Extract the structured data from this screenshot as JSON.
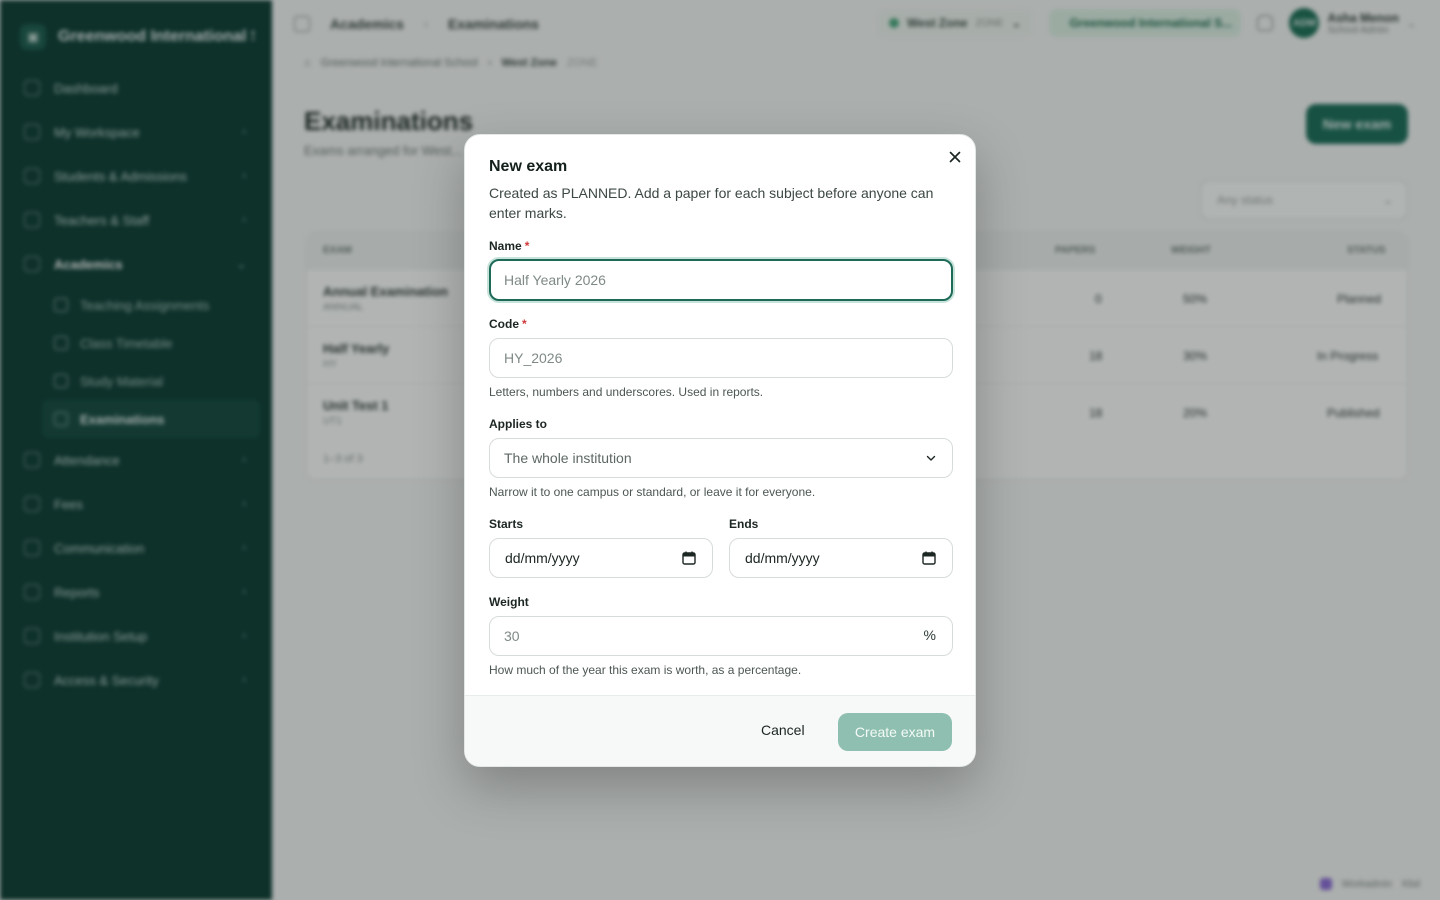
{
  "sidebar": {
    "brand": "Greenwood International Sc...",
    "items": [
      {
        "label": "Dashboard"
      },
      {
        "label": "My Workspace"
      },
      {
        "label": "Students & Admissions"
      },
      {
        "label": "Teachers & Staff"
      },
      {
        "label": "Academics"
      },
      {
        "label": "Attendance"
      },
      {
        "label": "Fees"
      },
      {
        "label": "Communication"
      },
      {
        "label": "Reports"
      },
      {
        "label": "Institution Setup"
      },
      {
        "label": "Access & Security"
      }
    ],
    "academics_sub": [
      {
        "label": "Teaching Assignments"
      },
      {
        "label": "Class Timetable"
      },
      {
        "label": "Study Material"
      },
      {
        "label": "Examinations"
      }
    ]
  },
  "topbar": {
    "crumb_1": "Academics",
    "crumb_2": "Examinations",
    "zone": "West Zone",
    "zone_code": "ZONE",
    "school": "Greenwood International S...",
    "user_initials": "ADM",
    "user_name": "Asha Menon",
    "user_role": "School Admin"
  },
  "page": {
    "crumb_1": "Greenwood International School",
    "crumb_2": "West Zone",
    "crumb_2_code": "ZONE",
    "title": "Examinations",
    "subtitle": "Exams arranged for West...",
    "new_exam_label": "New exam",
    "status_filter": "Any status"
  },
  "table": {
    "headers": {
      "exam": "EXAM",
      "papers": "PAPERS",
      "weight": "WEIGHT",
      "status": "STATUS"
    },
    "rows": [
      {
        "name": "Annual Examination",
        "code": "ANNUAL",
        "papers": "0",
        "weight": "50%",
        "status": "Planned"
      },
      {
        "name": "Half Yearly",
        "code": "HY",
        "papers": "18",
        "weight": "30%",
        "status": "In Progress"
      },
      {
        "name": "Unit Test 1",
        "code": "UT1",
        "papers": "18",
        "weight": "20%",
        "status": "Published"
      }
    ],
    "footer": "1–3 of 3"
  },
  "bottom_badge": {
    "label": "Workadmin",
    "extra": "Kbd"
  },
  "modal": {
    "title": "New exam",
    "description": "Created as PLANNED. Add a paper for each subject before anyone can enter marks.",
    "name_label": "Name",
    "name_placeholder": "Half Yearly 2026",
    "code_label": "Code",
    "code_placeholder": "HY_2026",
    "code_help": "Letters, numbers and underscores. Used in reports.",
    "applies_label": "Applies to",
    "applies_value": "The whole institution",
    "applies_help": "Narrow it to one campus or standard, or leave it for everyone.",
    "starts_label": "Starts",
    "starts_value": "dd/mm/yyyy",
    "ends_label": "Ends",
    "ends_value": "dd/mm/yyyy",
    "weight_label": "Weight",
    "weight_placeholder": "30",
    "weight_unit": "%",
    "weight_help": "How much of the year this exam is worth, as a percentage.",
    "required_mark": "*",
    "cancel_label": "Cancel",
    "create_label": "Create exam"
  },
  "colors": {
    "sidebar_bg": "#0c3b33",
    "accent": "#1e6a58",
    "create_button_disabled": "#8fbfb0",
    "required": "#d0393a"
  }
}
